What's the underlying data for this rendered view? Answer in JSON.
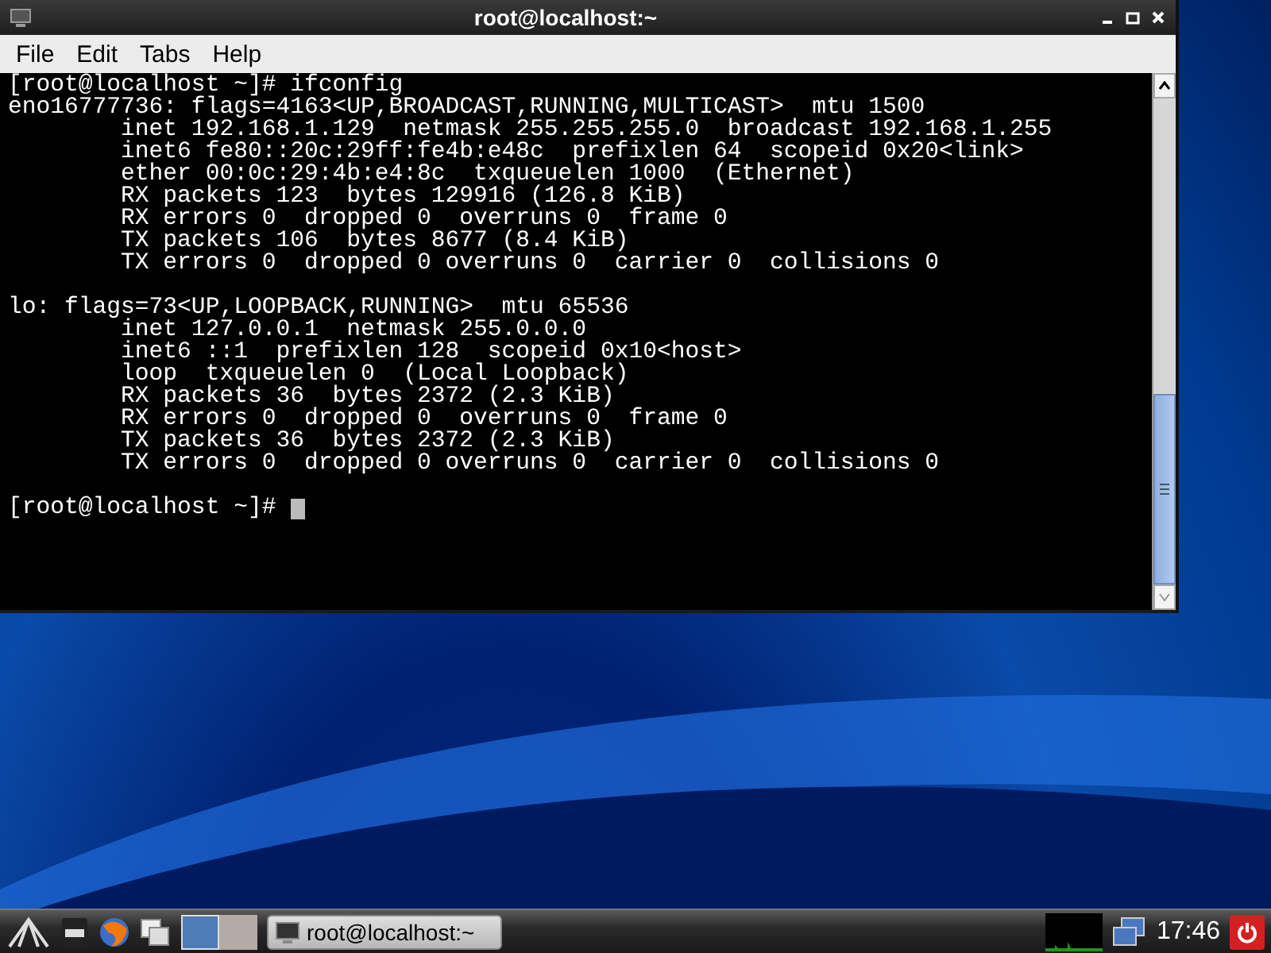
{
  "window": {
    "title": "root@localhost:~"
  },
  "menu": [
    {
      "label": "File"
    },
    {
      "label": "Edit"
    },
    {
      "label": "Tabs"
    },
    {
      "label": "Help"
    }
  ],
  "terminal": {
    "blocks": [
      [
        "[root@localhost ~]# ifconfig",
        "eno16777736: flags=4163<UP,BROADCAST,RUNNING,MULTICAST>  mtu 1500",
        "        inet 192.168.1.129  netmask 255.255.255.0  broadcast 192.168.1.255",
        "        inet6 fe80::20c:29ff:fe4b:e48c  prefixlen 64  scopeid 0x20<link>",
        "        ether 00:0c:29:4b:e4:8c  txqueuelen 1000  (Ethernet)",
        "        RX packets 123  bytes 129916 (126.8 KiB)",
        "        RX errors 0  dropped 0  overruns 0  frame 0",
        "        TX packets 106  bytes 8677 (8.4 KiB)",
        "        TX errors 0  dropped 0 overruns 0  carrier 0  collisions 0"
      ],
      [
        "lo: flags=73<UP,LOOPBACK,RUNNING>  mtu 65536",
        "        inet 127.0.0.1  netmask 255.0.0.0",
        "        inet6 ::1  prefixlen 128  scopeid 0x10<host>",
        "        loop  txqueuelen 0  (Local Loopback)",
        "        RX packets 36  bytes 2372 (2.3 KiB)",
        "        RX errors 0  dropped 0  overruns 0  frame 0",
        "        TX packets 36  bytes 2372 (2.3 KiB)",
        "        TX errors 0  dropped 0 overruns 0  carrier 0  collisions 0"
      ]
    ],
    "prompt": "[root@localhost ~]# "
  },
  "taskbar": {
    "workspaces": [
      {
        "selected": true
      },
      {
        "selected": false
      }
    ],
    "tasks": [
      {
        "label": "root@localhost:~"
      }
    ],
    "clock": "17:46"
  }
}
